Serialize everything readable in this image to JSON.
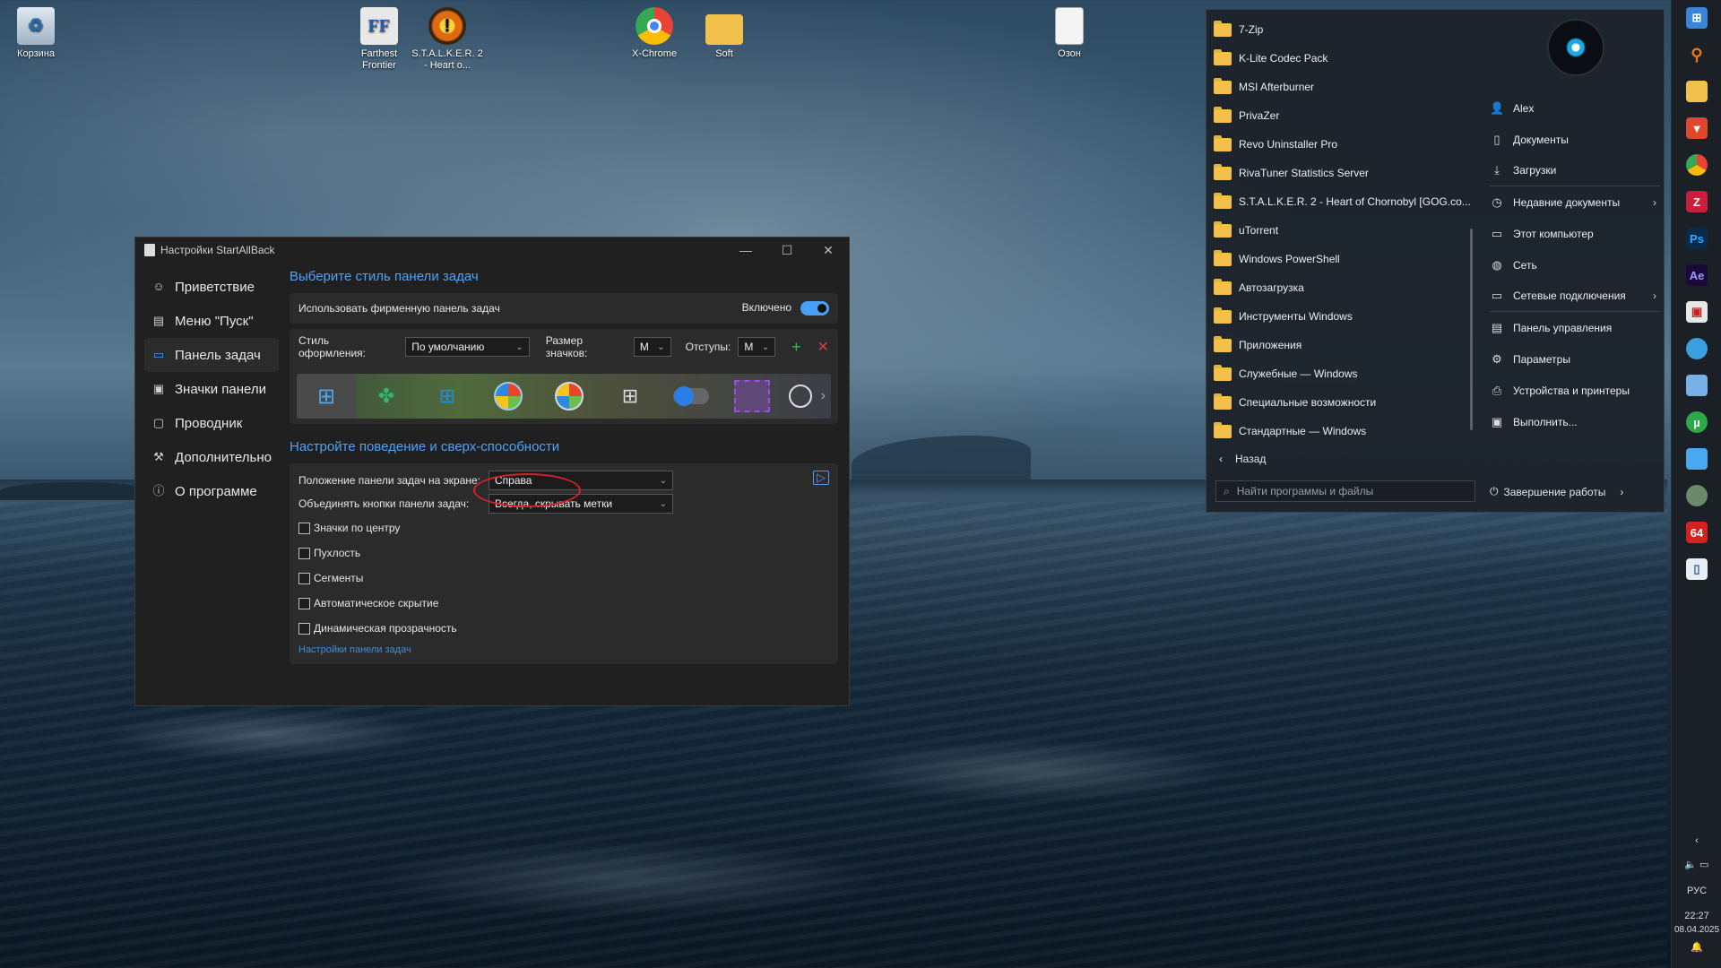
{
  "desktop": {
    "icons": [
      {
        "label": "Корзина",
        "icon": "recycle-bin-icon"
      },
      {
        "label": "Farthest Frontier",
        "icon": "ff-game-icon"
      },
      {
        "label": "S.T.A.L.K.E.R. 2 - Heart o...",
        "icon": "stalker-game-icon"
      },
      {
        "label": "X-Chrome",
        "icon": "chrome-icon"
      },
      {
        "label": "Soft",
        "icon": "folder-icon"
      },
      {
        "label": "Озон",
        "icon": "document-icon"
      }
    ]
  },
  "settings_window": {
    "title": "Настройки StartAllBack",
    "nav": [
      {
        "label": "Приветствие",
        "icon": "smile-icon"
      },
      {
        "label": "Меню \"Пуск\"",
        "icon": "start-menu-icon"
      },
      {
        "label": "Панель задач",
        "icon": "taskbar-icon",
        "active": true
      },
      {
        "label": "Значки панели",
        "icon": "tray-icons-icon"
      },
      {
        "label": "Проводник",
        "icon": "explorer-icon"
      },
      {
        "label": "Дополнительно",
        "icon": "wrench-icon"
      },
      {
        "label": "О программе",
        "icon": "info-icon"
      }
    ],
    "style_section": {
      "heading": "Выберите стиль панели задач",
      "use_branded_label": "Использовать фирменную панель задач",
      "enabled_label": "Включено",
      "style_label": "Стиль оформления:",
      "style_value": "По умолчанию",
      "icon_size_label": "Размер значков:",
      "icon_size_value": "M",
      "padding_label": "Отступы:",
      "padding_value": "M"
    },
    "behavior_section": {
      "heading": "Настройте поведение и сверх-способности",
      "position_label": "Положение панели задач на экране:",
      "position_value": "Справа",
      "combine_label": "Объединять кнопки панели задач:",
      "combine_value": "Всегда, скрывать метки",
      "checkboxes": [
        "Значки по центру",
        "Пухлость",
        "Сегменты",
        "Автоматическое скрытие",
        "Динамическая прозрачность"
      ],
      "link": "Настройки панели задач"
    }
  },
  "start_menu": {
    "programs": [
      "7-Zip",
      "K-Lite Codec Pack",
      "MSI Afterburner",
      "PrivaZer",
      "Revo Uninstaller Pro",
      "RivaTuner Statistics Server",
      "S.T.A.L.K.E.R. 2 - Heart of Chornobyl [GOG.co...",
      "uTorrent",
      "Windows PowerShell",
      "Автозагрузка",
      "Инструменты Windows",
      "Приложения",
      "Служебные — Windows",
      "Специальные возможности",
      "Стандартные — Windows"
    ],
    "back_label": "Назад",
    "search_placeholder": "Найти программы и файлы",
    "right_items": [
      {
        "label": "Alex",
        "icon": "user-icon"
      },
      {
        "label": "Документы",
        "icon": "documents-icon"
      },
      {
        "label": "Загрузки",
        "icon": "download-icon"
      },
      {
        "label": "Недавние документы",
        "icon": "clock-icon"
      },
      {
        "label": "Этот компьютер",
        "icon": "computer-icon"
      },
      {
        "label": "Сеть",
        "icon": "network-icon"
      },
      {
        "label": "Сетевые подключения",
        "icon": "network-connections-icon"
      },
      {
        "label": "Панель управления",
        "icon": "control-panel-icon"
      },
      {
        "label": "Параметры",
        "icon": "gear-icon"
      },
      {
        "label": "Устройства и принтеры",
        "icon": "printer-icon"
      },
      {
        "label": "Выполнить...",
        "icon": "run-icon"
      }
    ],
    "shutdown_label": "Завершение работы"
  },
  "taskbar": {
    "language": "РУС",
    "time": "22:27",
    "date": "08.04.2025"
  }
}
